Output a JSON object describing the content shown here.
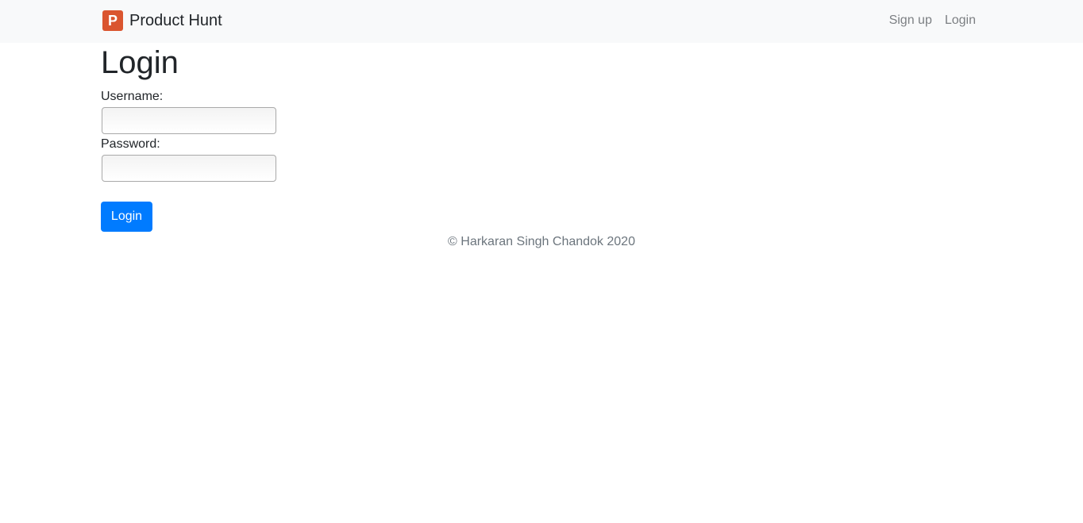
{
  "navbar": {
    "brand": {
      "logo_letter": "P",
      "logo_icon": "product-hunt-logo-icon",
      "logo_color": "#da552f",
      "name": "Product Hunt"
    },
    "links": [
      {
        "label": "Sign up"
      },
      {
        "label": "Login"
      }
    ]
  },
  "main": {
    "title": "Login",
    "form": {
      "username_label": "Username:",
      "username_value": "",
      "password_label": "Password:",
      "password_value": "",
      "submit_label": "Login",
      "submit_color": "#007bff"
    }
  },
  "footer": {
    "text": "© Harkaran Singh Chandok 2020"
  }
}
